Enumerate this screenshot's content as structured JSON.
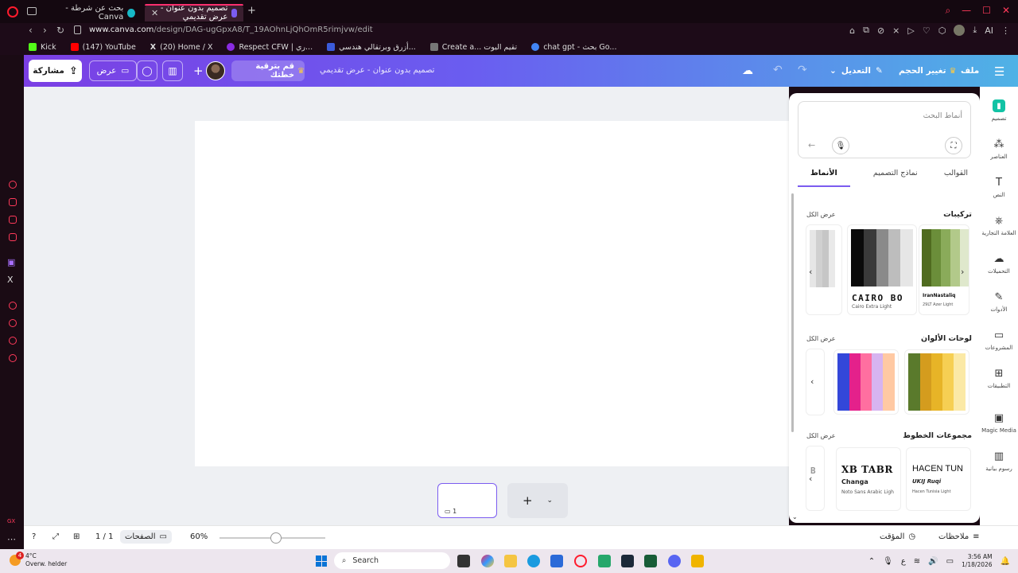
{
  "browser": {
    "tabs": [
      {
        "title": "بحث عن شرطة - Canva",
        "active": false
      },
      {
        "title": "تصميم بدون عنوان - عرض تقديمي",
        "active": true
      }
    ],
    "new_tab": "+",
    "url_domain": "www.canva.com",
    "url_path": "/design/DAG-ugGpxA8/T_19AOhnLjQhOmR5rimjvw/edit",
    "profile_label": "AI",
    "bookmarks": [
      {
        "label": "Kick",
        "color": "#53fc18"
      },
      {
        "label": "(147) YouTube",
        "color": "#ff0000"
      },
      {
        "label": "(20) Home / X",
        "color": "#000000"
      },
      {
        "label": "Respect CFW | ري...",
        "color": "#8a2be2"
      },
      {
        "label": "أزرق وبرتقالي هندسي...",
        "color": "#3b5bdb"
      },
      {
        "label": "Create a... تقيم اليوت",
        "color": "#555555"
      },
      {
        "label": "chat gpt - بحث Go...",
        "color": "#4285f4"
      }
    ]
  },
  "topbar": {
    "share": "مشاركة",
    "present": "عرض",
    "upgrade": "قم بترقية خطتك",
    "doc_title": "تصميم بدون عنوان - عرض تقديمي",
    "edit": "التعديل",
    "resize": "تغيير الحجم",
    "file": "ملف"
  },
  "panel": {
    "search_placeholder": "أنماط البحث",
    "tabs": [
      "القوالب",
      "نماذج التصميم",
      "الأنماط"
    ],
    "active_tab": "الأنماط",
    "sections": {
      "combos": {
        "title": "تركيبات",
        "see_all": "عرض الكل"
      },
      "palettes": {
        "title": "لوحات الألوان",
        "see_all": "عرض الكل"
      },
      "fonts": {
        "title": "مجموعات الخطوط",
        "see_all": "عرض الكل"
      }
    },
    "combo_cards": [
      {
        "font_big": "CAIRO BO",
        "font_small": "Cairo Extra Light",
        "colors": [
          "#0a0a0a",
          "#3a3a3a",
          "#8a8a8a",
          "#bdbdbd",
          "#e6e6e6"
        ]
      },
      {
        "font_big": "IranNastaliq",
        "font_small": "29LT Azer Light",
        "colors": [
          "#4f6b1f",
          "#6b8e3a",
          "#8aab5a",
          "#b2c98a",
          "#dfe8cc"
        ]
      }
    ],
    "palette_cards": [
      {
        "colors": [
          "#3347d9",
          "#e4218b",
          "#ff6fa0",
          "#d7b4f0",
          "#ffc9a3"
        ]
      },
      {
        "colors": [
          "#5a7a2c",
          "#d49c1e",
          "#e7b427",
          "#f6cf53",
          "#fbe9a6"
        ]
      }
    ],
    "font_cards": [
      {
        "big": "XB TABR",
        "mid": "Changa",
        "small": "Noto Sans Arabic Ligh"
      },
      {
        "big": "HACEN TUN",
        "mid": "UKIJ Ruqi",
        "small": "Hacen Tunisia Light"
      }
    ],
    "partial_first_card": "B"
  },
  "rail": [
    {
      "label": "تصميم",
      "icon": "design-icon",
      "active": true
    },
    {
      "label": "العناصر",
      "icon": "elements-icon"
    },
    {
      "label": "النص",
      "icon": "text-icon"
    },
    {
      "label": "العلامة التجارية",
      "icon": "brand-icon"
    },
    {
      "label": "التحميلات",
      "icon": "upload-icon"
    },
    {
      "label": "الأدوات",
      "icon": "tools-icon"
    },
    {
      "label": "المشروعات",
      "icon": "folder-icon"
    },
    {
      "label": "التطبيقات",
      "icon": "apps-icon"
    },
    {
      "label": "Magic Media",
      "icon": "magic-media-icon"
    },
    {
      "label": "رسوم بيانية",
      "icon": "charts-icon"
    }
  ],
  "thumbnail": {
    "page_number": "1"
  },
  "statusbar": {
    "pages_label": "الصفحات",
    "page_count": "1 / 1",
    "zoom": "60%",
    "timer": "المؤقت",
    "notes": "ملاحظات"
  },
  "taskbar": {
    "temperature": "4°C",
    "weather_desc": "Overw. helder",
    "weather_badge": "4",
    "search": "Search",
    "time": "3:56 AM",
    "date": "1/18/2026",
    "lang": "ع"
  },
  "colors": {
    "accent": "#7b5cf0",
    "canva_teal": "#12c3a5",
    "opera_red": "#ff1b2d"
  }
}
